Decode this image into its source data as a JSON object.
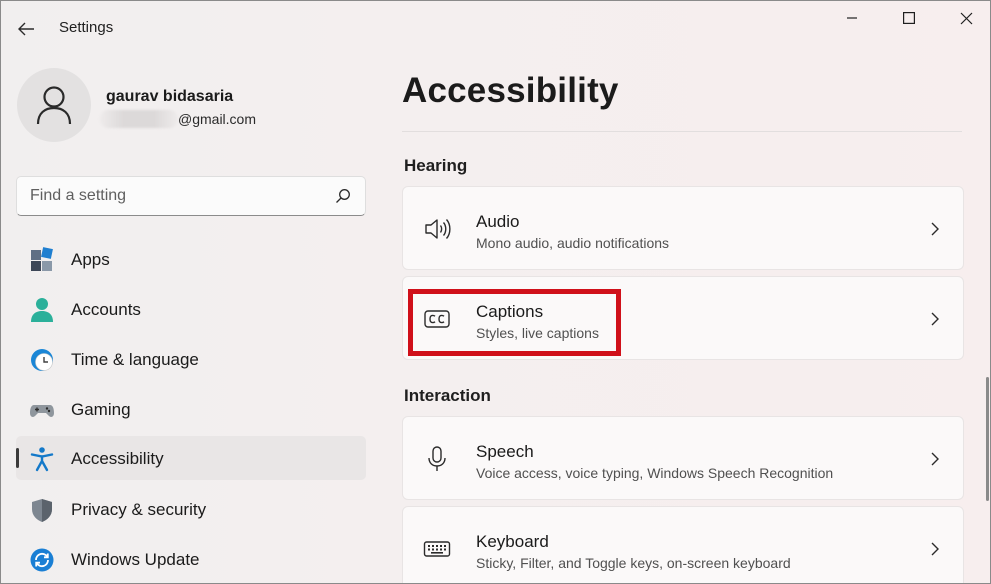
{
  "window": {
    "title": "Settings"
  },
  "profile": {
    "name": "gaurav bidasaria",
    "email": "@gmail.com"
  },
  "search": {
    "placeholder": "Find a setting"
  },
  "sidebar": {
    "items": [
      {
        "label": "Apps",
        "icon": "apps-icon"
      },
      {
        "label": "Accounts",
        "icon": "accounts-icon"
      },
      {
        "label": "Time & language",
        "icon": "time-language-icon"
      },
      {
        "label": "Gaming",
        "icon": "gaming-icon"
      },
      {
        "label": "Accessibility",
        "icon": "accessibility-icon",
        "active": true
      },
      {
        "label": "Privacy & security",
        "icon": "shield-icon"
      },
      {
        "label": "Windows Update",
        "icon": "windows-update-icon"
      }
    ]
  },
  "main": {
    "title": "Accessibility",
    "sections": [
      {
        "header": "Hearing",
        "cards": [
          {
            "title": "Audio",
            "subtitle": "Mono audio, audio notifications",
            "icon": "speaker-icon"
          },
          {
            "title": "Captions",
            "subtitle": "Styles, live captions",
            "icon": "closed-captions-icon"
          }
        ]
      },
      {
        "header": "Interaction",
        "cards": [
          {
            "title": "Speech",
            "subtitle": "Voice access, voice typing, Windows Speech Recognition",
            "icon": "microphone-icon"
          },
          {
            "title": "Keyboard",
            "subtitle": "Sticky, Filter, and Toggle keys, on-screen keyboard",
            "icon": "keyboard-icon"
          }
        ]
      }
    ]
  },
  "colors": {
    "highlight": "#d0101a",
    "accent": "#0067c0"
  }
}
